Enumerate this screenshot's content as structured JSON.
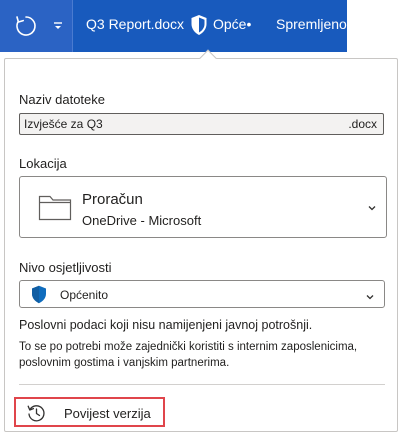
{
  "titlebar": {
    "document_title": "Q3 Report.docx",
    "sensitivity_short": "Opće•",
    "save_status": "Spremljeno"
  },
  "panel": {
    "filename": {
      "label": "Naziv datoteke",
      "value": "Izvješće za Q3",
      "extension": ".docx"
    },
    "location": {
      "label": "Lokacija",
      "folder_name": "Proračun",
      "folder_path": "OneDrive - Microsoft"
    },
    "sensitivity": {
      "label": "Nivo osjetljivosti",
      "value": "Općenito",
      "description_title": "Poslovni podaci koji nisu namijenjeni javnoj potrošnji.",
      "description_body": "To se po potrebi može zajednički koristiti s internim zaposlenicima, poslovnim gostima i vanjskim partnerima."
    },
    "version_history": {
      "label": "Povijest verzija"
    }
  },
  "colors": {
    "titlebar_bg": "#185abd",
    "shield_blue": "#0f6cbd",
    "highlight_red": "#e0454b"
  },
  "icons": [
    "refresh-icon",
    "chevron-down-icon",
    "shield-icon",
    "folder-icon",
    "history-icon"
  ]
}
